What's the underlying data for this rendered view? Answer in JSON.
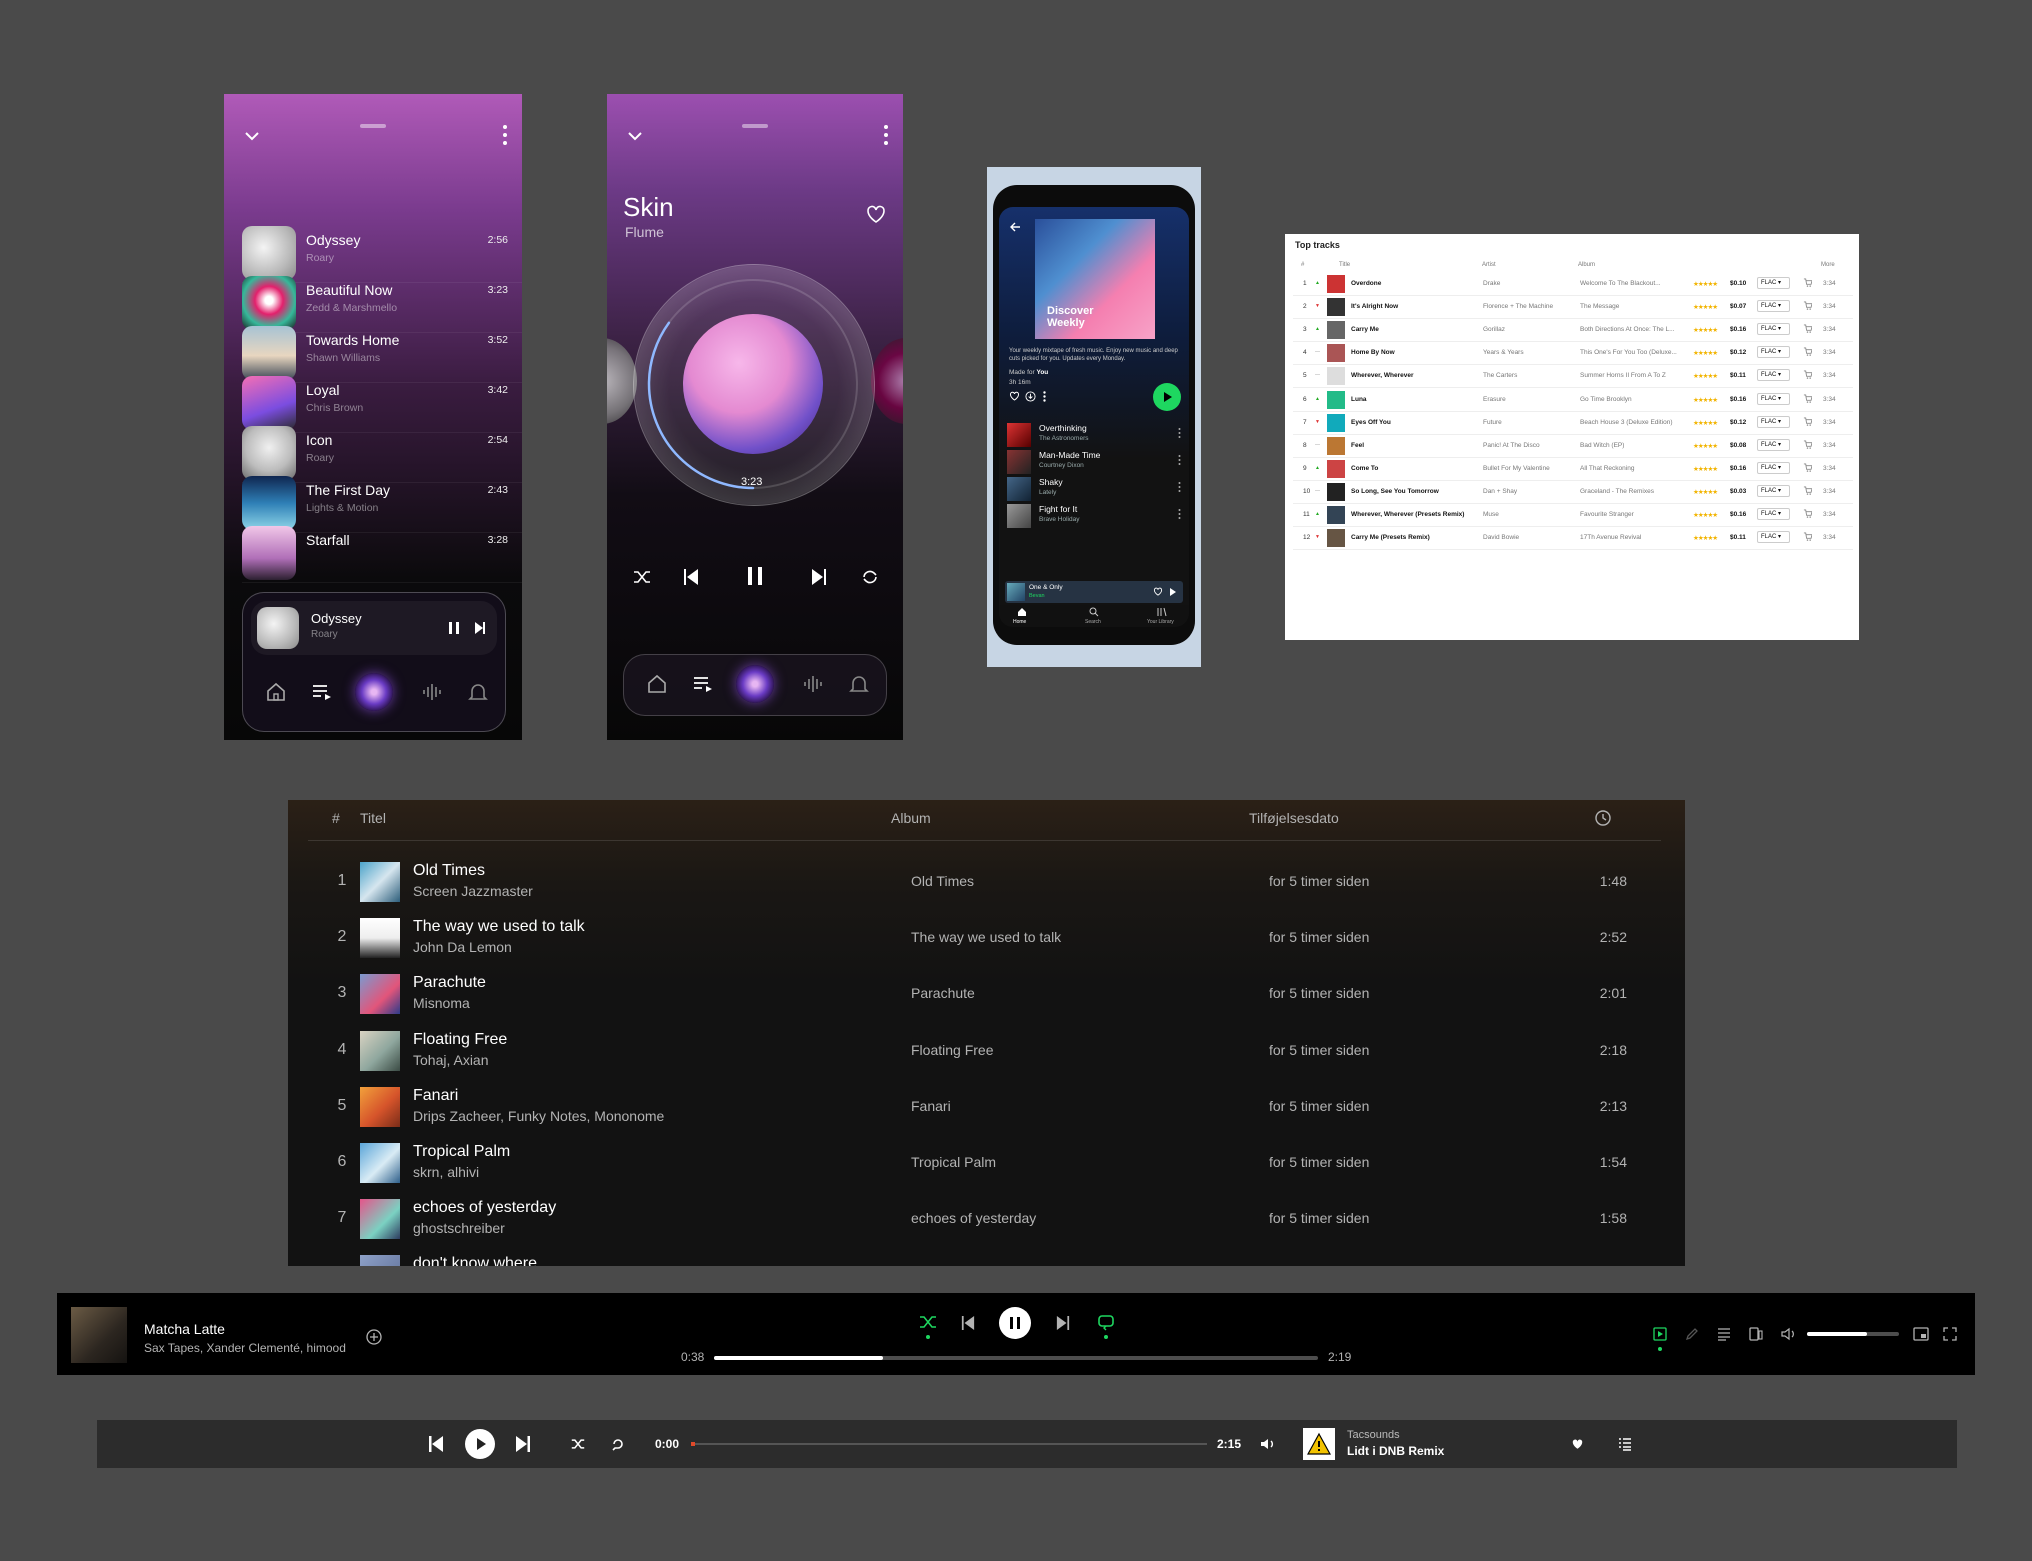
{
  "phone1": {
    "tracks": [
      {
        "title": "Odyssey",
        "artist": "Roary",
        "duration": "2:56"
      },
      {
        "title": "Beautiful Now",
        "artist": "Zedd & Marshmello",
        "duration": "3:23"
      },
      {
        "title": "Towards Home",
        "artist": "Shawn Williams",
        "duration": "3:52"
      },
      {
        "title": "Loyal",
        "artist": "Chris Brown",
        "duration": "3:42"
      },
      {
        "title": "Icon",
        "artist": "Roary",
        "duration": "2:54"
      },
      {
        "title": "The First Day",
        "artist": "Lights & Motion",
        "duration": "2:43"
      },
      {
        "title": "Starfall",
        "artist": "",
        "duration": "3:28"
      }
    ],
    "now_playing": {
      "title": "Odyssey",
      "artist": "Roary"
    }
  },
  "phone2": {
    "title": "Skin",
    "artist": "Flume",
    "time": "3:23",
    "progress": 0.35
  },
  "phone3": {
    "cover_line1": "Discover",
    "cover_line2": "Weekly",
    "description": "Your weekly mixtape of fresh music. Enjoy new music and deep cuts picked for you. Updates every Monday.",
    "made_for_label": "Made for",
    "made_for_user": "You",
    "length": "3h 16m",
    "tracks": [
      {
        "title": "Overthinking",
        "artist": "The Astronomers"
      },
      {
        "title": "Man-Made Time",
        "artist": "Courtney Dixon"
      },
      {
        "title": "Shaky",
        "artist": "Lately"
      },
      {
        "title": "Fight for It",
        "artist": "Brave Holiday"
      }
    ],
    "mini": {
      "title": "One & Only",
      "artist": "Bevan"
    },
    "nav": [
      "Home",
      "Search",
      "Your Library"
    ]
  },
  "top_tracks": {
    "title": "Top tracks",
    "headers": {
      "rank": "#",
      "title": "Title",
      "artist": "Artist",
      "album": "Album",
      "more": "More"
    },
    "rows": [
      {
        "rank": "1",
        "trend": "▲",
        "title": "Overdone",
        "artist": "Drake",
        "album": "Welcome To The Blackout...",
        "rating": "★★★★★",
        "price": "$0.10",
        "format": "FLAC",
        "duration": "3:34"
      },
      {
        "rank": "2",
        "trend": "▼",
        "title": "It's Alright Now",
        "artist": "Florence + The Machine",
        "album": "The Message",
        "rating": "★★★★★",
        "price": "$0.07",
        "format": "FLAC",
        "duration": "3:34"
      },
      {
        "rank": "3",
        "trend": "▲",
        "title": "Carry Me",
        "artist": "Gorillaz",
        "album": "Both Directions At Once: The L...",
        "rating": "★★★★★",
        "price": "$0.16",
        "format": "FLAC",
        "duration": "3:34"
      },
      {
        "rank": "4",
        "trend": "—",
        "title": "Home By Now",
        "artist": "Years & Years",
        "album": "This One's For You Too (Deluxe...",
        "rating": "★★★★★",
        "price": "$0.12",
        "format": "FLAC",
        "duration": "3:34"
      },
      {
        "rank": "5",
        "trend": "—",
        "title": "Wherever, Wherever",
        "artist": "The Carters",
        "album": "Summer Horns II From A To Z",
        "rating": "★★★★★",
        "price": "$0.11",
        "format": "FLAC",
        "duration": "3:34"
      },
      {
        "rank": "6",
        "trend": "▲",
        "title": "Luna",
        "artist": "Erasure",
        "album": "Go Time Brooklyn",
        "rating": "★★★★★",
        "price": "$0.16",
        "format": "FLAC",
        "duration": "3:34"
      },
      {
        "rank": "7",
        "trend": "▼",
        "title": "Eyes Off You",
        "artist": "Future",
        "album": "Beach House 3 (Deluxe Edition)",
        "rating": "★★★★★",
        "price": "$0.12",
        "format": "FLAC",
        "duration": "3:34"
      },
      {
        "rank": "8",
        "trend": "—",
        "title": "Feel",
        "artist": "Panic! At The Disco",
        "album": "Bad Witch (EP)",
        "rating": "★★★★★",
        "price": "$0.08",
        "format": "FLAC",
        "duration": "3:34"
      },
      {
        "rank": "9",
        "trend": "▲",
        "title": "Come To",
        "artist": "Bullet For My Valentine",
        "album": "All That Reckoning",
        "rating": "★★★★★",
        "price": "$0.16",
        "format": "FLAC",
        "duration": "3:34"
      },
      {
        "rank": "10",
        "trend": "—",
        "title": "So Long, See You Tomorrow",
        "artist": "Dan + Shay",
        "album": "Graceland - The Remixes",
        "rating": "★★★★★",
        "price": "$0.03",
        "format": "FLAC",
        "duration": "3:34"
      },
      {
        "rank": "11",
        "trend": "▲",
        "title": "Wherever, Wherever (Presets Remix)",
        "artist": "Muse",
        "album": "Favourite Stranger",
        "rating": "★★★★★",
        "price": "$0.16",
        "format": "FLAC",
        "duration": "3:34"
      },
      {
        "rank": "12",
        "trend": "▼",
        "title": "Carry Me (Presets Remix)",
        "artist": "David Bowie",
        "album": "17Th Avenue Revival",
        "rating": "★★★★★",
        "price": "$0.11",
        "format": "FLAC",
        "duration": "3:34"
      }
    ]
  },
  "playlist": {
    "headers": {
      "num": "#",
      "title": "Titel",
      "album": "Album",
      "date": "Tilføjelsesdato"
    },
    "rows": [
      {
        "n": "1",
        "title": "Old Times",
        "artist": "Screen Jazzmaster",
        "album": "Old Times",
        "date": "for 5 timer siden",
        "duration": "1:48"
      },
      {
        "n": "2",
        "title": "The way we used to talk",
        "artist": "John Da Lemon",
        "album": "The way we used to talk",
        "date": "for 5 timer siden",
        "duration": "2:52"
      },
      {
        "n": "3",
        "title": "Parachute",
        "artist": "Misnoma",
        "album": "Parachute",
        "date": "for 5 timer siden",
        "duration": "2:01"
      },
      {
        "n": "4",
        "title": "Floating Free",
        "artist": "Tohaj, Axian",
        "album": "Floating Free",
        "date": "for 5 timer siden",
        "duration": "2:18"
      },
      {
        "n": "5",
        "title": "Fanari",
        "artist": "Drips Zacheer, Funky Notes, Mononome",
        "album": "Fanari",
        "date": "for 5 timer siden",
        "duration": "2:13"
      },
      {
        "n": "6",
        "title": "Tropical Palm",
        "artist": "skrn, alhivi",
        "album": "Tropical Palm",
        "date": "for 5 timer siden",
        "duration": "1:54"
      },
      {
        "n": "7",
        "title": "echoes of yesterday",
        "artist": "ghostschreiber",
        "album": "echoes of yesterday",
        "date": "for 5 timer siden",
        "duration": "1:58"
      },
      {
        "n": "",
        "title": "don't know where",
        "artist": "",
        "album": "",
        "date": "",
        "duration": ""
      }
    ]
  },
  "spotify_bar": {
    "title": "Matcha Latte",
    "artist": "Sax Tapes, Xander Clementé, himood",
    "elapsed": "0:38",
    "total": "2:19",
    "progress": 0.28,
    "volume": 0.65,
    "accent": "#1ed760"
  },
  "bottom_bar": {
    "elapsed": "0:00",
    "total": "2:15",
    "label": "Tacsounds",
    "track": "Lidt i DNB Remix",
    "progress": 0.0
  }
}
